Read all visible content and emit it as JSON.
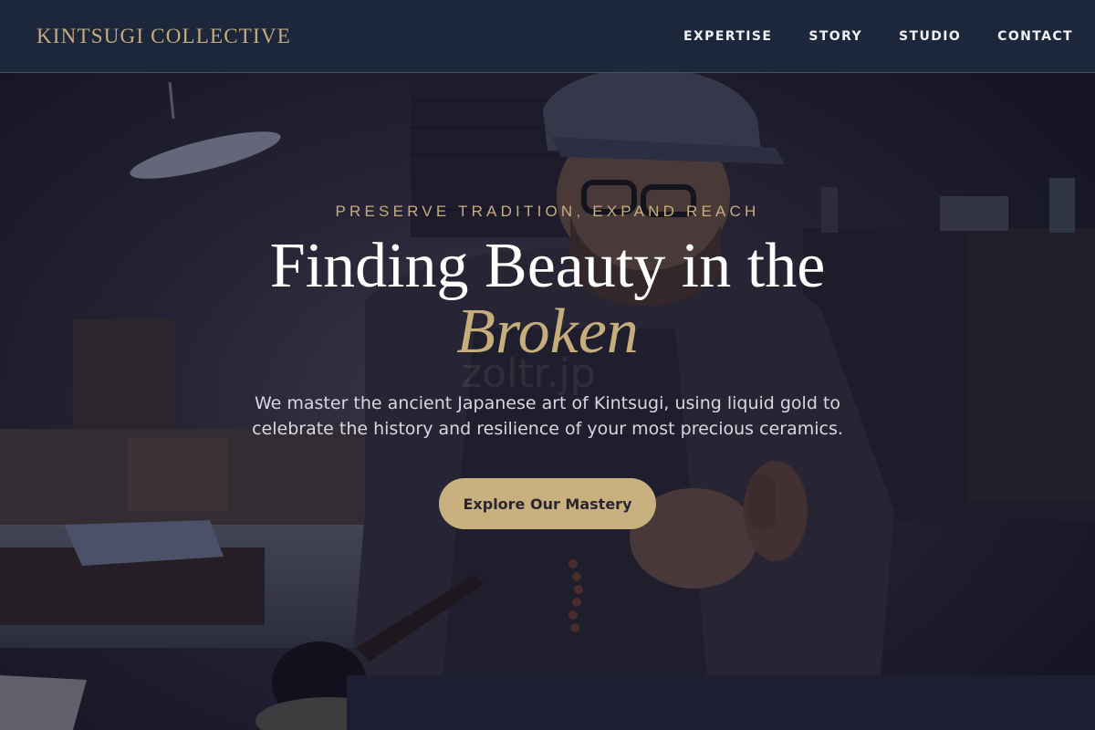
{
  "brand": {
    "name": "KINTSUGI COLLECTIVE",
    "color": "#c6ad7c"
  },
  "nav": {
    "items": [
      {
        "label": "EXPERTISE"
      },
      {
        "label": "STORY"
      },
      {
        "label": "STUDIO"
      },
      {
        "label": "CONTACT"
      }
    ]
  },
  "hero": {
    "eyebrow": "PRESERVE TRADITION, EXPAND REACH",
    "headline_main": "Finding Beauty in the",
    "headline_accent": "Broken",
    "description": "We master the ancient Japanese art of Kintsugi, using liquid gold to celebrate the history and resilience of your most precious ceramics.",
    "cta_label": "Explore Our Mastery",
    "watermark": "zoltr.jp",
    "image_subject": "artisan-at-workbench-photo"
  },
  "colors": {
    "accent_gold": "#c6ad7c",
    "button_bg": "#c8b17f",
    "navbar_bg": "#1d293d",
    "overlay": "#141426"
  }
}
